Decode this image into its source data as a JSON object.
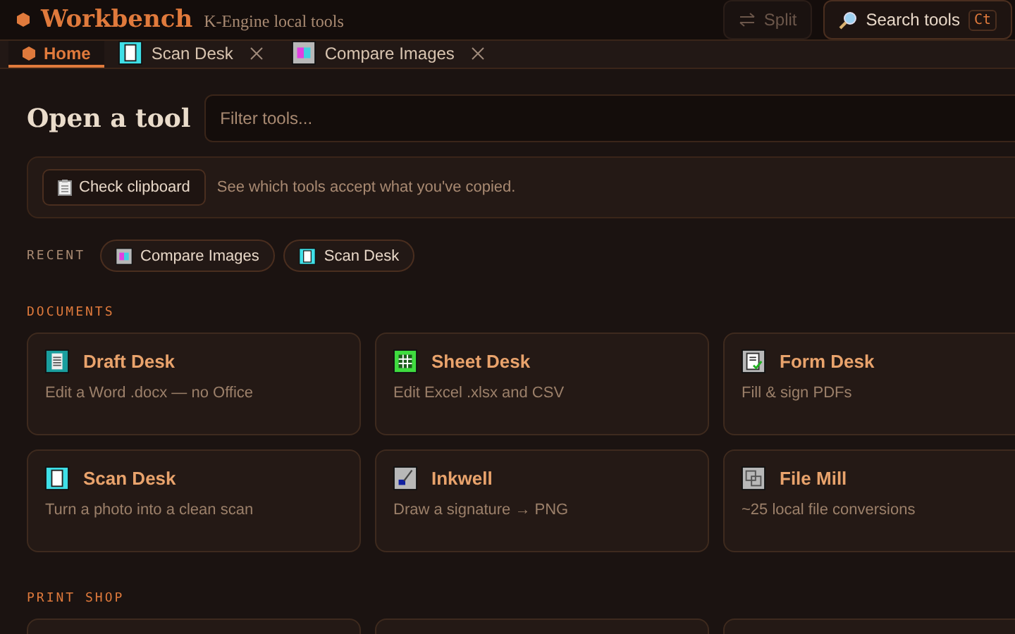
{
  "header": {
    "logo": "Workbench",
    "subtitle": "K-Engine local tools",
    "split_button": {
      "label": "Split",
      "disabled": true
    },
    "search_button": {
      "label": "Search tools",
      "shortcut": "Ct"
    }
  },
  "tabs": [
    {
      "label": "Home",
      "kind": "home",
      "selected": true,
      "closable": false
    },
    {
      "label": "Scan Desk",
      "kind": "scan",
      "selected": false,
      "closable": true
    },
    {
      "label": "Compare Images",
      "kind": "compare",
      "selected": false,
      "closable": true
    }
  ],
  "heading": "Open a tool",
  "filter": {
    "placeholder": "Filter tools..."
  },
  "clipboard": {
    "button": "Check clipboard",
    "hint": "See which tools accept what you've copied."
  },
  "recent": {
    "label": "RECENT",
    "items": [
      {
        "label": "Compare Images",
        "kind": "compare"
      },
      {
        "label": "Scan Desk",
        "kind": "scan"
      }
    ]
  },
  "sections": [
    {
      "title": "DOCUMENTS",
      "tools": [
        {
          "name": "Draft Desk",
          "description": "Edit a Word .docx — no Office",
          "kind": "draft"
        },
        {
          "name": "Sheet Desk",
          "description": "Edit Excel .xlsx and CSV",
          "kind": "sheet"
        },
        {
          "name": "Form Desk",
          "description": "Fill & sign PDFs",
          "kind": "form"
        },
        {
          "name": "Scan Desk",
          "description": "Turn a photo into a clean scan",
          "kind": "scan"
        },
        {
          "name": "Inkwell",
          "description": "Draw a signature → PNG",
          "kind": "ink"
        },
        {
          "name": "File Mill",
          "description": "~25 local file conversions",
          "kind": "mill"
        }
      ]
    },
    {
      "title": "PRINT SHOP"
    }
  ]
}
